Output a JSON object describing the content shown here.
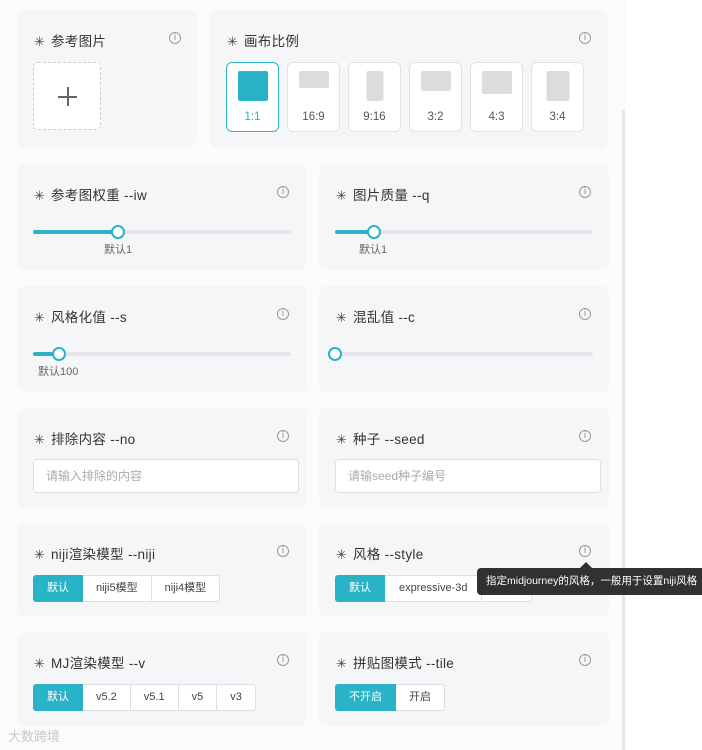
{
  "reference_image": {
    "title": "参考图片",
    "upload_icon": "plus-icon"
  },
  "canvas_ratio": {
    "title": "画布比例",
    "options": [
      "1:1",
      "16:9",
      "9:16",
      "3:2",
      "4:3",
      "3:4"
    ],
    "selected": "1:1"
  },
  "image_weight": {
    "title": "参考图权重 --iw",
    "default_label": "默认1",
    "value_fraction": 0.33
  },
  "quality": {
    "title": "图片质量 --q",
    "default_label": "默认1",
    "value_fraction": 0.15
  },
  "stylize": {
    "title": "风格化值 --s",
    "default_label": "默认100",
    "value_fraction": 0.1
  },
  "chaos": {
    "title": "混乱值 --c",
    "value_fraction": 0.0
  },
  "exclude": {
    "title": "排除内容 --no",
    "placeholder": "请输入排除的内容"
  },
  "seed": {
    "title": "种子 --seed",
    "placeholder": "请输seed种子编号"
  },
  "niji_model": {
    "title": "niji渲染模型 --niji",
    "options": [
      "默认",
      "niji5模型",
      "niji4模型"
    ],
    "selected": "默认"
  },
  "style": {
    "title": "风格 --style",
    "options": [
      "默认",
      "expressive-3d"
    ],
    "selected": "默认",
    "tooltip": "指定midjourney的风格，一般用于设置niji风格"
  },
  "mj_model": {
    "title": "MJ渲染模型 --v",
    "options": [
      "默认",
      "v5.2",
      "v5.1",
      "v5",
      "v3"
    ],
    "selected": "默认"
  },
  "tile": {
    "title": "拼贴图模式 --tile",
    "options": [
      "不开启",
      "开启"
    ],
    "selected": "不开启"
  },
  "watermark": "大数跨境",
  "colors": {
    "accent": "#2ab3c7",
    "card_bg": "#f5f6f8",
    "tooltip_bg": "#303133"
  }
}
